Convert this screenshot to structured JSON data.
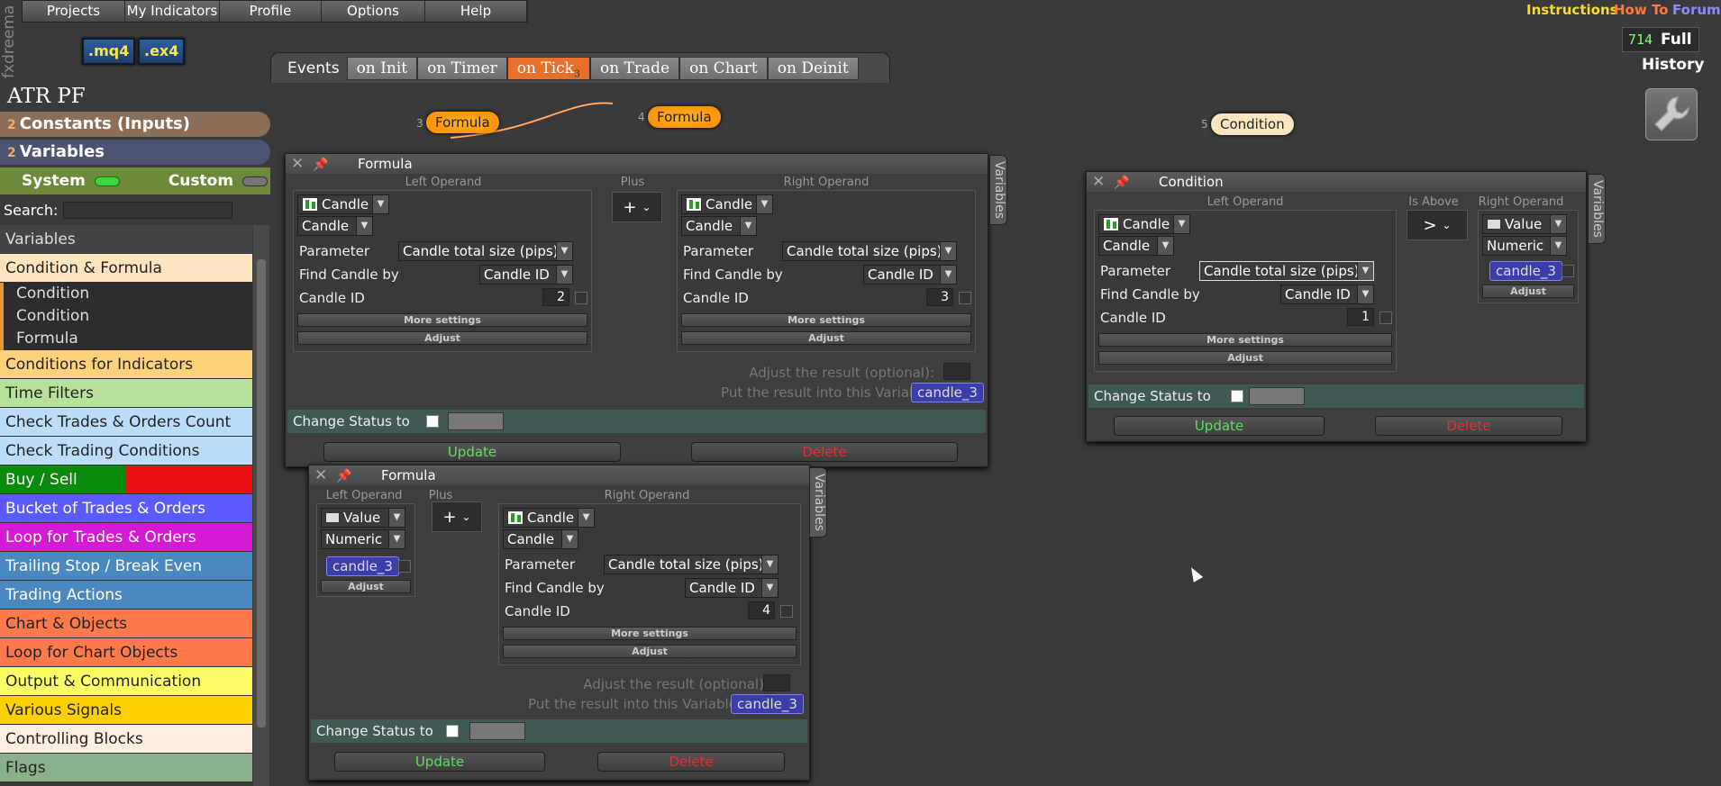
{
  "menu": [
    "Projects",
    "My Indicators",
    "Profile",
    "Options",
    "Help"
  ],
  "brand": "fxdreema",
  "format_buttons": [
    ".mq4",
    ".ex4"
  ],
  "top_links": {
    "instructions": "Instructions",
    "howto": "How To",
    "forum": "Forum"
  },
  "counter": {
    "value": "714",
    "full": "Full"
  },
  "history": "History",
  "events": {
    "label": "Events",
    "tabs": [
      {
        "label": "on Init"
      },
      {
        "label": "on Timer"
      },
      {
        "label": "on Tick",
        "count": "3"
      },
      {
        "label": "on Trade"
      },
      {
        "label": "on Chart"
      },
      {
        "label": "on Deinit"
      }
    ]
  },
  "project_title": "ATR PF",
  "constants": {
    "count": "2",
    "label": "Constants (Inputs)"
  },
  "variables": {
    "count": "2",
    "label": "Variables"
  },
  "system_label": "System",
  "custom_label": "Custom",
  "search_label": "Search:",
  "categories": [
    {
      "label": "Variables",
      "bg": "#444444",
      "fg": "#dddddd"
    },
    {
      "label": "Condition & Formula",
      "bg": "#fde3c0",
      "fg": "#222222"
    },
    {
      "label": "Conditions for Indicators",
      "bg": "#ffd27a",
      "fg": "#222222"
    },
    {
      "label": "Time Filters",
      "bg": "#b8e29a",
      "fg": "#222222"
    },
    {
      "label": "Check Trades & Orders Count",
      "bg": "#bcdcfa",
      "fg": "#222222"
    },
    {
      "label": "Check Trading Conditions",
      "bg": "#bcdcfa",
      "fg": "#222222"
    },
    {
      "label": "Buy / Sell",
      "bg": "#e81010",
      "fg": "#ffffff"
    },
    {
      "label": "Bucket of Trades & Orders",
      "bg": "#5a5aff",
      "fg": "#ffffff"
    },
    {
      "label": "Loop for Trades & Orders",
      "bg": "#d41ad4",
      "fg": "#ffffff"
    },
    {
      "label": "Trailing Stop / Break Even",
      "bg": "#4a88c0",
      "fg": "#ffffff"
    },
    {
      "label": "Trading Actions",
      "bg": "#4a88c0",
      "fg": "#ffffff"
    },
    {
      "label": "Chart & Objects",
      "bg": "#ff7a4a",
      "fg": "#222222"
    },
    {
      "label": "Loop for Chart Objects",
      "bg": "#ff7a4a",
      "fg": "#222222"
    },
    {
      "label": "Output & Communication",
      "bg": "#ffff66",
      "fg": "#222222"
    },
    {
      "label": "Various Signals",
      "bg": "#ffd000",
      "fg": "#222222"
    },
    {
      "label": "Controlling Blocks",
      "bg": "#fdeee0",
      "fg": "#222222"
    },
    {
      "label": "Flags",
      "bg": "#8ab08a",
      "fg": "#222222"
    }
  ],
  "subitems": [
    "Condition",
    "Condition",
    "Formula"
  ],
  "nodes": [
    {
      "num": "3",
      "label": "Formula"
    },
    {
      "num": "4",
      "label": "Formula"
    },
    {
      "num": "5",
      "label": "Condition"
    }
  ],
  "formula1": {
    "title": "Formula",
    "variables_tab": "Variables",
    "left_label": "Left Operand",
    "op_label": "Plus",
    "right_label": "Right Operand",
    "left": {
      "type": "Candle",
      "sub": "Candle",
      "parameter_label": "Parameter",
      "parameter": "Candle total size (pips)",
      "find_label": "Find Candle by",
      "find": "Candle ID",
      "id_label": "Candle ID",
      "id": "2",
      "more": "More settings",
      "adjust": "Adjust"
    },
    "op": "+",
    "right": {
      "type": "Candle",
      "sub": "Candle",
      "parameter_label": "Parameter",
      "parameter": "Candle total size (pips)",
      "find_label": "Find Candle by",
      "find": "Candle ID",
      "id_label": "Candle ID",
      "id": "3",
      "more": "More settings",
      "adjust": "Adjust"
    },
    "adjust_result": "Adjust the result (optional):",
    "put_result": "Put the result into this Variable:",
    "result_var": "candle_3",
    "status": "Change Status to",
    "update": "Update",
    "delete": "Delete"
  },
  "formula2": {
    "title": "Formula",
    "variables_tab": "Variables",
    "left_label": "Left Operand",
    "op_label": "Plus",
    "right_label": "Right Operand",
    "left": {
      "type": "Value",
      "sub": "Numeric",
      "var": "candle_3",
      "adjust": "Adjust"
    },
    "op": "+",
    "right": {
      "type": "Candle",
      "sub": "Candle",
      "parameter_label": "Parameter",
      "parameter": "Candle total size (pips)",
      "find_label": "Find Candle by",
      "find": "Candle ID",
      "id_label": "Candle ID",
      "id": "4",
      "more": "More settings",
      "adjust": "Adjust"
    },
    "adjust_result": "Adjust the result (optional):",
    "put_result": "Put the result into this Variable:",
    "result_var": "candle_3",
    "status": "Change Status to",
    "update": "Update",
    "delete": "Delete"
  },
  "condition": {
    "title": "Condition",
    "variables_tab": "Variables",
    "left_label": "Left Operand",
    "op_label": "Is Above",
    "right_label": "Right Operand",
    "left": {
      "type": "Candle",
      "sub": "Candle",
      "parameter_label": "Parameter",
      "parameter": "Candle total size (pips)",
      "find_label": "Find Candle by",
      "find": "Candle ID",
      "id_label": "Candle ID",
      "id": "1",
      "more": "More settings",
      "adjust": "Adjust"
    },
    "op": ">",
    "right": {
      "type": "Value",
      "sub": "Numeric",
      "var": "candle_3",
      "adjust": "Adjust"
    },
    "status": "Change Status to",
    "update": "Update",
    "delete": "Delete"
  }
}
